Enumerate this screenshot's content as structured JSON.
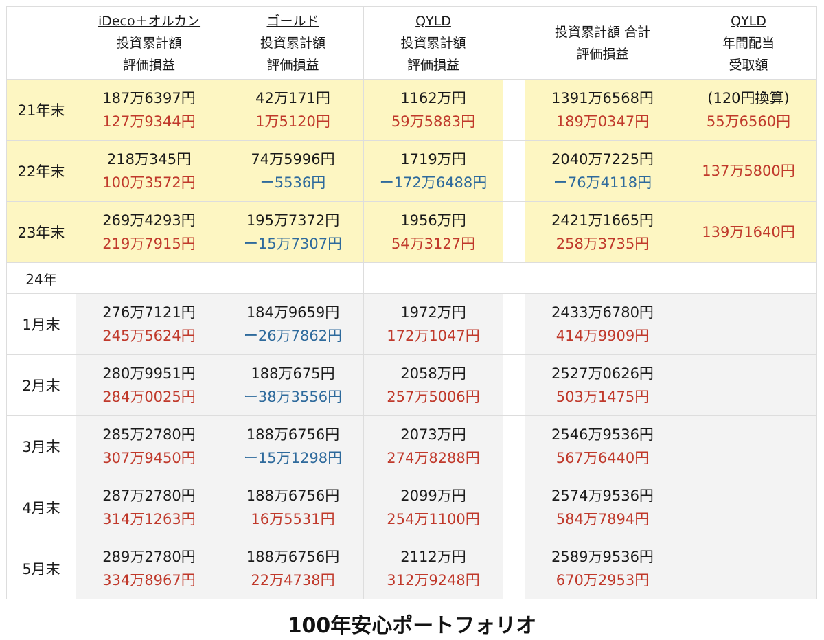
{
  "headers": [
    {
      "title": "iDeco＋オルカン",
      "sub1": "投資累計額",
      "sub2": "評価損益"
    },
    {
      "title": "ゴールド",
      "sub1": "投資累計額",
      "sub2": "評価損益"
    },
    {
      "title": "QYLD",
      "sub1": "投資累計額",
      "sub2": "評価損益"
    },
    {
      "title": "",
      "sub1": "投資累計額 合計",
      "sub2": "評価損益"
    },
    {
      "title": "QYLD",
      "sub1": "年間配当",
      "sub2": "受取額"
    }
  ],
  "yearly": [
    {
      "label": "21年末",
      "ideco": {
        "invested": "187万6397円",
        "pl": "127万9344円"
      },
      "gold": {
        "invested": "42万171円",
        "pl": "1万5120円"
      },
      "qyld": {
        "invested": "1162万円",
        "pl": "59万5883円"
      },
      "total": {
        "invested": "1391万6568円",
        "pl": "189万0347円"
      },
      "dividend": {
        "note": "(120円換算)",
        "amount": "55万6560円"
      }
    },
    {
      "label": "22年末",
      "ideco": {
        "invested": "218万345円",
        "pl": "100万3572円"
      },
      "gold": {
        "invested": "74万5996円",
        "pl": "ー5536円"
      },
      "qyld": {
        "invested": "1719万円",
        "pl": "ー172万6488円"
      },
      "total": {
        "invested": "2040万7225円",
        "pl": "ー76万4118円"
      },
      "dividend": {
        "note": "",
        "amount": "137万5800円"
      }
    },
    {
      "label": "23年末",
      "ideco": {
        "invested": "269万4293円",
        "pl": "219万7915円"
      },
      "gold": {
        "invested": "195万7372円",
        "pl": "ー15万7307円"
      },
      "qyld": {
        "invested": "1956万円",
        "pl": "54万3127円"
      },
      "total": {
        "invested": "2421万1665円",
        "pl": "258万3735円"
      },
      "dividend": {
        "note": "",
        "amount": "139万1640円"
      }
    }
  ],
  "section_label": "24年",
  "monthly": [
    {
      "label": "1月末",
      "ideco": {
        "invested": "276万7121円",
        "pl": "245万5624円"
      },
      "gold": {
        "invested": "184万9659円",
        "pl": "ー26万7862円"
      },
      "qyld": {
        "invested": "1972万円",
        "pl": "172万1047円"
      },
      "total": {
        "invested": "2433万6780円",
        "pl": "414万9909円"
      }
    },
    {
      "label": "2月末",
      "ideco": {
        "invested": "280万9951円",
        "pl": "284万0025円"
      },
      "gold": {
        "invested": "188万675円",
        "pl": "ー38万3556円"
      },
      "qyld": {
        "invested": "2058万円",
        "pl": "257万5006円"
      },
      "total": {
        "invested": "2527万0626円",
        "pl": "503万1475円"
      }
    },
    {
      "label": "3月末",
      "ideco": {
        "invested": "285万2780円",
        "pl": "307万9450円"
      },
      "gold": {
        "invested": "188万6756円",
        "pl": "ー15万1298円"
      },
      "qyld": {
        "invested": "2073万円",
        "pl": "274万8288円"
      },
      "total": {
        "invested": "2546万9536円",
        "pl": "567万6440円"
      }
    },
    {
      "label": "4月末",
      "ideco": {
        "invested": "287万2780円",
        "pl": "314万1263円"
      },
      "gold": {
        "invested": "188万6756円",
        "pl": "16万5531円"
      },
      "qyld": {
        "invested": "2099万円",
        "pl": "254万1100円"
      },
      "total": {
        "invested": "2574万9536円",
        "pl": "584万7894円"
      }
    },
    {
      "label": "5月末",
      "ideco": {
        "invested": "289万2780円",
        "pl": "334万8967円"
      },
      "gold": {
        "invested": "188万6756円",
        "pl": "22万4738円"
      },
      "qyld": {
        "invested": "2112万円",
        "pl": "312万9248円"
      },
      "total": {
        "invested": "2589万9536円",
        "pl": "670万2953円"
      }
    }
  ],
  "caption": "100年安心ポートフォリオ",
  "colors": {
    "profit": "#c0392b",
    "loss": "#2e6a9c",
    "yearly_bg": "#fdf6c2",
    "monthly_bg": "#f3f3f3"
  }
}
